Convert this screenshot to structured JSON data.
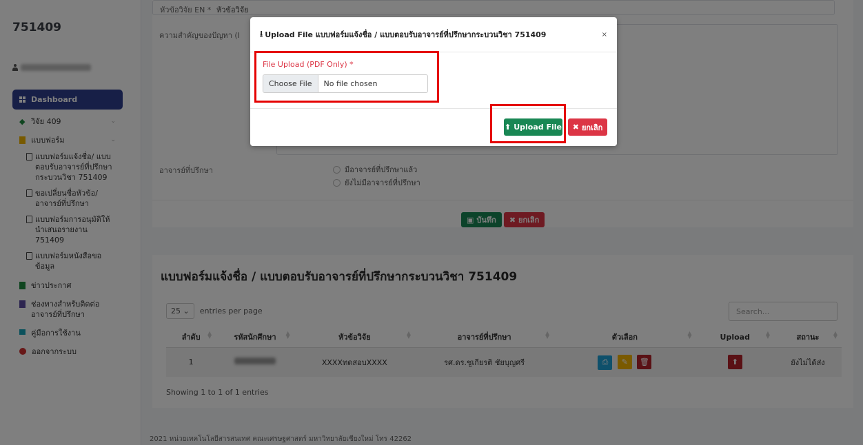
{
  "sidebar": {
    "course_code": "751409",
    "items": [
      {
        "label": "Dashboard"
      },
      {
        "label": "วิจัย 409"
      },
      {
        "label": "แบบฟอร์ม"
      },
      {
        "label": "แบบฟอร์มแจ้งชื่อ/ แบบตอบรับอาจารย์ที่ปรึกษากระบวนวิชา 751409"
      },
      {
        "label": "ขอเปลี่ยนชื่อหัวข้อ/ อาจารย์ที่ปรึกษา"
      },
      {
        "label": "แบบฟอร์มการอนุมัติให้นำเสนอรายงาน 751409"
      },
      {
        "label": "แบบฟอร์มหนังสือขอข้อมูล"
      },
      {
        "label": "ข่าวประกาศ"
      },
      {
        "label": "ช่องทางสำหรับติดต่ออาจารย์ที่ปรึกษา"
      },
      {
        "label": "คู่มือการใช้งาน"
      },
      {
        "label": "ออกจากระบบ"
      }
    ]
  },
  "form": {
    "title_en_label": "หัวข้อวิจัย EN *",
    "title_en_value": "หัวข้อวิจัย",
    "importance_label": "ความสำคัญของปัญหา (I",
    "advisor_label": "อาจารย์ที่ปรึกษา",
    "advisor_options": [
      "มีอาจารย์ที่ปรึกษาแล้ว",
      "ยังไม่มีอาจารย์ที่ปรึกษา"
    ],
    "save_label": "บันทึก",
    "cancel_label": "ยกเลิก"
  },
  "table_section": {
    "title": "แบบฟอร์มแจ้งชื่อ / แบบตอบรับอาจารย์ที่ปรึกษากระบวนวิชา 751409",
    "page_size": "25",
    "entries_label": "entries per page",
    "search_placeholder": "Search...",
    "columns": [
      "ลำดับ",
      "รหัสนักศึกษา",
      "หัวข้อวิจัย",
      "อาจารย์ที่ปรึกษา",
      "ตัวเลือก",
      "Upload",
      "สถานะ"
    ],
    "rows": [
      {
        "no": "1",
        "title": "XXXXทดสอบXXXX",
        "advisor": "รศ.ดร.ชูเกียรติ ชัยบุญศรี",
        "status": "ยังไม่ได้ส่ง"
      }
    ],
    "showing": "Showing 1 to 1 of 1 entries"
  },
  "footer": {
    "text": "2021 หน่วยเทคโนโลยีสารสนเทศ คณะเศรษฐศาสตร์ มหาวิทยาลัยเชียงใหม่ โทร 42262"
  },
  "modal": {
    "title": "Upload File แบบฟอร์มแจ้งชื่อ / แบบตอบรับอาจารย์ที่ปรึกษากระบวนวิชา 751409",
    "close": "×",
    "file_label": "File Upload (PDF Only) *",
    "choose_file": "Choose File",
    "no_file": "No file chosen",
    "upload_button": "Upload File",
    "cancel_button": "ยกเลิก"
  },
  "colors": {
    "sidebar_active": "#2f3f8f",
    "primary_green": "#198754",
    "danger_red": "#dc3545",
    "highlight_red": "#e50000"
  }
}
